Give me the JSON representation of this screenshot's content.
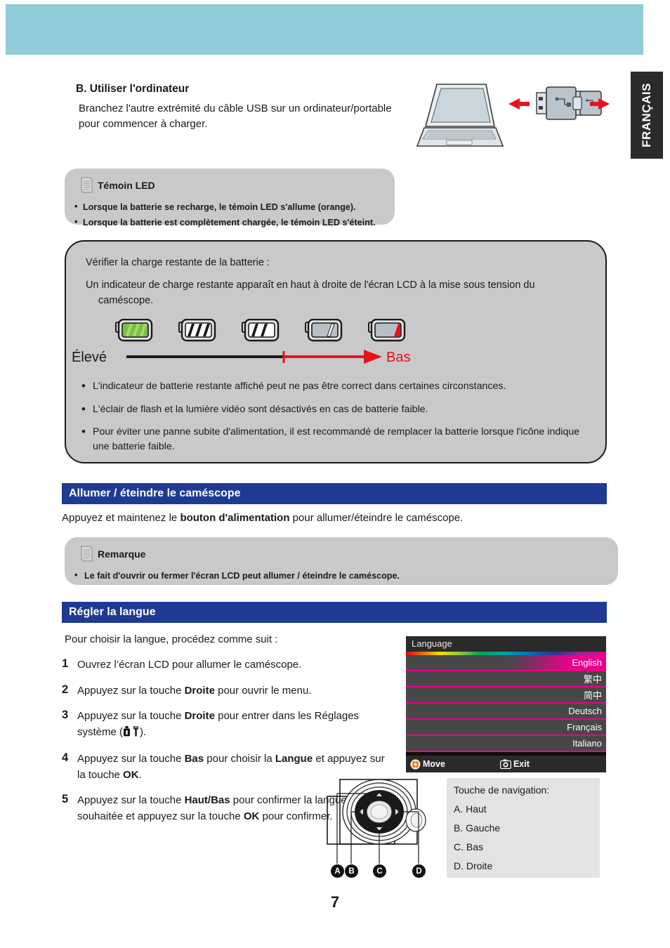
{
  "header": {
    "band_color": "#90cbd8"
  },
  "language_tab": {
    "label": "FRANÇAIS"
  },
  "section_b": {
    "heading": "B. Utiliser l'ordinateur",
    "body": "Branchez l'autre extrémité du câble USB sur un ordinateur/portable pour commencer à charger."
  },
  "illustration": {
    "laptop": "laptop-icon",
    "usb_a": "usb-a-connector-icon",
    "usb_mini": "usb-mini-connector-icon",
    "arrow_color": "#e8121a"
  },
  "note_led": {
    "title": "Témoin LED",
    "items": [
      "Lorsque la batterie se recharge, le témoin LED s'allume (orange).",
      "Lorsque la batterie est complètement chargée, le témoin LED s'éteint."
    ]
  },
  "battery_panel": {
    "line1": "Vérifier la charge restante de la batterie :",
    "line2": "Un indicateur de charge restante apparaît en haut à droite de l'écran LCD à la mise sous tension du",
    "line2_cont": "caméscope.",
    "scale": {
      "high_label": "Élevé",
      "low_label": "Bas",
      "high_color": "#1a1a1a",
      "low_color": "#e8121a"
    },
    "icons": [
      {
        "name": "battery-full-icon",
        "bars": 3,
        "fill": "#7ac143",
        "level": "full"
      },
      {
        "name": "battery-three-quarter-icon",
        "bars": 3,
        "fill": "#ffffff",
        "level": "high"
      },
      {
        "name": "battery-half-icon",
        "bars": 2,
        "fill": "#ffffff",
        "level": "medium"
      },
      {
        "name": "battery-low-icon",
        "bars": 1,
        "fill": "#ffffff",
        "level": "low"
      },
      {
        "name": "battery-empty-icon",
        "bars": 1,
        "fill": "#e8121a",
        "level": "empty"
      }
    ],
    "bullets": [
      "L'indicateur de batterie restante affiché peut ne pas être correct dans certaines circonstances.",
      "L'éclair de flash et la lumière vidéo sont désactivés en cas de batterie faible.",
      "Pour éviter une panne subite d'alimentation, il est recommandé de remplacer la batterie lorsque l'icône indique une batterie faible."
    ]
  },
  "section_power": {
    "bar_title": "Allumer / éteindre le caméscope",
    "paragraph_pre": "Appuyez et maintenez le ",
    "paragraph_bold": "bouton d'alimentation",
    "paragraph_post": " pour allumer/éteindre le caméscope.",
    "note": {
      "title": "Remarque",
      "items": [
        "Le fait d'ouvrir ou fermer l'écran LCD peut allumer / éteindre le caméscope."
      ]
    }
  },
  "section_language": {
    "bar_title": "Régler la langue",
    "intro": "Pour choisir la langue, procédez comme suit :",
    "steps": [
      {
        "num": "1",
        "parts": [
          {
            "t": "Ouvrez l’écran LCD pour allumer le caméscope.",
            "b": false
          }
        ]
      },
      {
        "num": "2",
        "parts": [
          {
            "t": "Appuyez sur la touche ",
            "b": false
          },
          {
            "t": "Droite",
            "b": true
          },
          {
            "t": " pour ouvrir le menu.",
            "b": false
          }
        ]
      },
      {
        "num": "3",
        "parts": [
          {
            "t": "Appuyez sur la touche ",
            "b": false
          },
          {
            "t": "Droite",
            "b": true
          },
          {
            "t": " pour entrer dans les Réglages système (",
            "b": false
          },
          {
            "t": "ICONS",
            "b": false
          },
          {
            "t": ").",
            "b": false
          }
        ]
      },
      {
        "num": "4",
        "parts": [
          {
            "t": "Appuyez sur la touche ",
            "b": false
          },
          {
            "t": "Bas",
            "b": true
          },
          {
            "t": " pour choisir la ",
            "b": false
          },
          {
            "t": "Langue",
            "b": true
          },
          {
            "t": " et appuyez sur la touche ",
            "b": false
          },
          {
            "t": "OK",
            "b": true
          },
          {
            "t": ".",
            "b": false
          }
        ]
      },
      {
        "num": "5",
        "parts": [
          {
            "t": "Appuyez sur la touche ",
            "b": false
          },
          {
            "t": "Haut/Bas",
            "b": true
          },
          {
            "t": " pour confirmer la langue souhaitée et appuyez sur la touche ",
            "b": false
          },
          {
            "t": "OK",
            "b": true
          },
          {
            "t": " pour confirmer.",
            "b": false
          }
        ]
      }
    ]
  },
  "osd": {
    "title": "Language",
    "rows": [
      {
        "label": "English",
        "selected": true
      },
      {
        "label": "繁中",
        "selected": false
      },
      {
        "label": "简中",
        "selected": false
      },
      {
        "label": "Deutsch",
        "selected": false
      },
      {
        "label": "Français",
        "selected": false
      },
      {
        "label": "Italiano",
        "selected": false
      }
    ],
    "footer": {
      "move_label": "Move",
      "move_icon": "dpad-icon",
      "exit_label": "Exit",
      "exit_icon": "camera-icon"
    },
    "accent_color": "#ec008c"
  },
  "nav_figure": {
    "callouts": [
      "A",
      "B",
      "C",
      "D"
    ]
  },
  "nav_legend": {
    "title": "Touche de navigation:",
    "items": [
      "A. Haut",
      "B. Gauche",
      "C. Bas",
      "D. Droite"
    ]
  },
  "page_number": "7"
}
